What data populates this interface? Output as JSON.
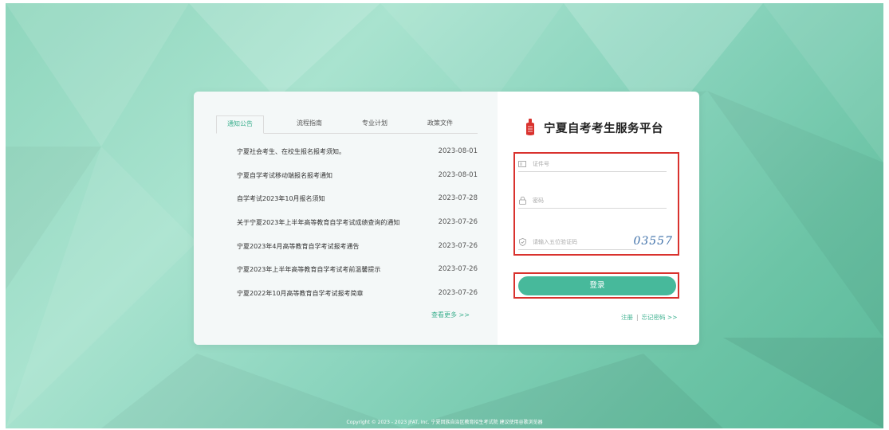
{
  "tabs": [
    {
      "label": "通知公告",
      "active": true
    },
    {
      "label": "流程指南",
      "active": false
    },
    {
      "label": "专业计划",
      "active": false
    },
    {
      "label": "政策文件",
      "active": false
    }
  ],
  "news": [
    {
      "title": "宁夏社会考生、在校生报名报考须知。",
      "date": "2023-08-01"
    },
    {
      "title": "宁夏自学考试移动端报名报考通知",
      "date": "2023-08-01"
    },
    {
      "title": "自学考试2023年10月报名须知",
      "date": "2023-07-28"
    },
    {
      "title": "关于宁夏2023年上半年高等教育自学考试成绩查询的通知",
      "date": "2023-07-26"
    },
    {
      "title": "宁夏2023年4月高等教育自学考试报考通告",
      "date": "2023-07-26"
    },
    {
      "title": "宁夏2023年上半年高等教育自学考试考前温馨提示",
      "date": "2023-07-26"
    },
    {
      "title": "宁夏2022年10月高等教育自学考试报考简章",
      "date": "2023-07-26"
    }
  ],
  "more_label": "查看更多 >>",
  "brand": {
    "title": "宁夏自考考生服务平台"
  },
  "form": {
    "id_placeholder": "证件号",
    "password_placeholder": "密码",
    "captcha_placeholder": "请输入五位验证码",
    "captcha_code": "03557"
  },
  "login_label": "登录",
  "links": {
    "register": "注册",
    "forgot": "忘记密码 >>"
  },
  "footer": "Copyright © 2023 - 2023 JFAT, Inc. 宁夏回族自治区教育招生考试院 建议使用谷歌浏览器",
  "colors": {
    "accent": "#47b99b",
    "highlight": "#d9322e"
  }
}
